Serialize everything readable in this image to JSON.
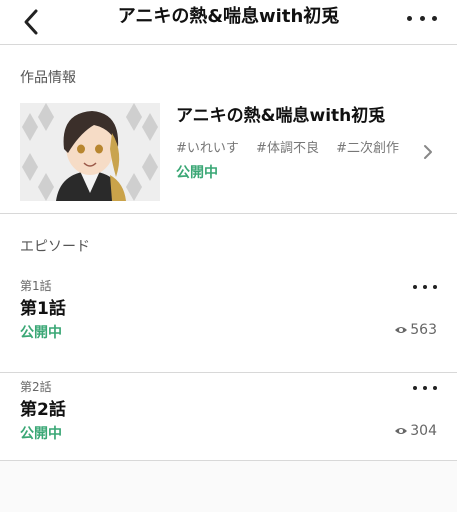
{
  "header": {
    "title": "アニキの熱&喘息with初兎"
  },
  "work_info": {
    "section_label": "作品情報",
    "title": "アニキの熱&喘息with初兎",
    "tags": [
      "#いれいす",
      "#体調不良",
      "#二次創作"
    ],
    "status": "公開中"
  },
  "episodes": {
    "section_label": "エピソード",
    "items": [
      {
        "number": "第1話",
        "title": "第1話",
        "status": "公開中",
        "views": "563"
      },
      {
        "number": "第2話",
        "title": "第2話",
        "status": "公開中",
        "views": "304"
      }
    ]
  },
  "colors": {
    "status_green": "#3aa775",
    "text": "#111111",
    "divider": "#d8d8d8"
  },
  "icons": {
    "back": "chevron-left-icon",
    "more": "more-dots-icon",
    "open": "chevron-right-icon",
    "views": "eye-icon"
  }
}
